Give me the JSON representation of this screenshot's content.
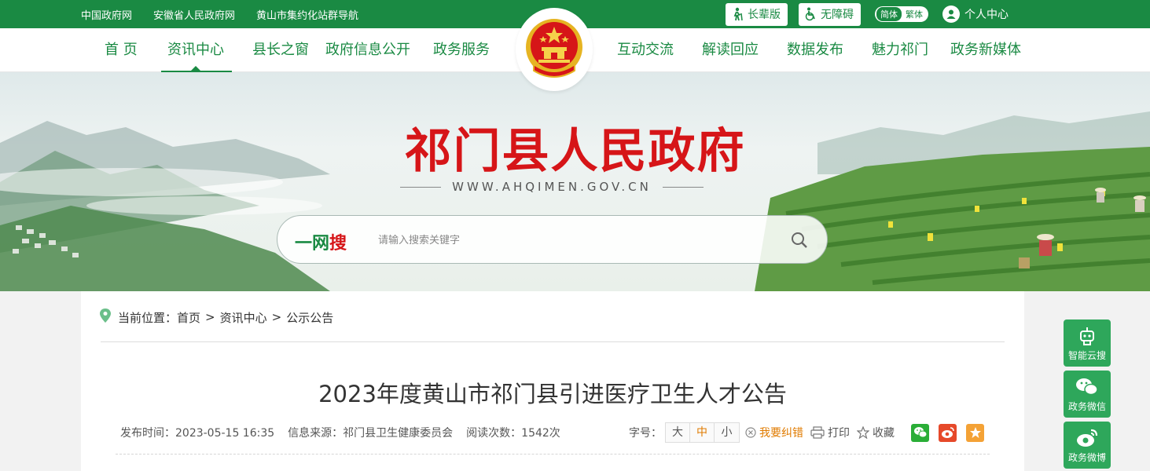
{
  "topbar": {
    "links": [
      "中国政府网",
      "安徽省人民政府网",
      "黄山市集约化站群导航"
    ],
    "elder_btn": "长辈版",
    "accessible_btn": "无障碍",
    "lang_simple": "简体",
    "lang_traditional": "繁体",
    "user_center": "个人中心"
  },
  "nav": {
    "items": [
      "首 页",
      "资讯中心",
      "县长之窗",
      "政府信息公开",
      "政务服务",
      "互动交流",
      "解读回应",
      "数据发布",
      "魅力祁门",
      "政务新媒体"
    ],
    "active": "资讯中心"
  },
  "banner": {
    "title": "祁门县人民政府",
    "url": "WWW.AHQIMEN.GOV.CN",
    "search_brand_green": "一网",
    "search_brand_red": "搜",
    "search_placeholder": "请输入搜索关键字"
  },
  "breadcrumb": {
    "prefix": "当前位置：",
    "items": [
      "首页",
      "资讯中心",
      "公示公告"
    ],
    "separator": ">"
  },
  "article": {
    "title": "2023年度黄山市祁门县引进医疗卫生人才公告",
    "publish_time": "发布时间：2023-05-15 16:35",
    "source": "信息来源：祁门县卫生健康委员会",
    "views": "阅读次数：1542次"
  },
  "tools": {
    "font_label": "字号：",
    "font_sizes": [
      "大",
      "中",
      "小"
    ],
    "font_current": "中",
    "report_error": "我要纠错",
    "print": "打印",
    "favorite": "收藏"
  },
  "float_bar": [
    "智能云搜",
    "政务微信",
    "政务微博"
  ],
  "colors": {
    "primary_green": "#1a8a43",
    "title_red": "#d61518",
    "accent_orange": "#e07b00",
    "wechat_green": "#2aae37",
    "weibo_orange": "#e6492a",
    "star_orange": "#f4a236"
  }
}
